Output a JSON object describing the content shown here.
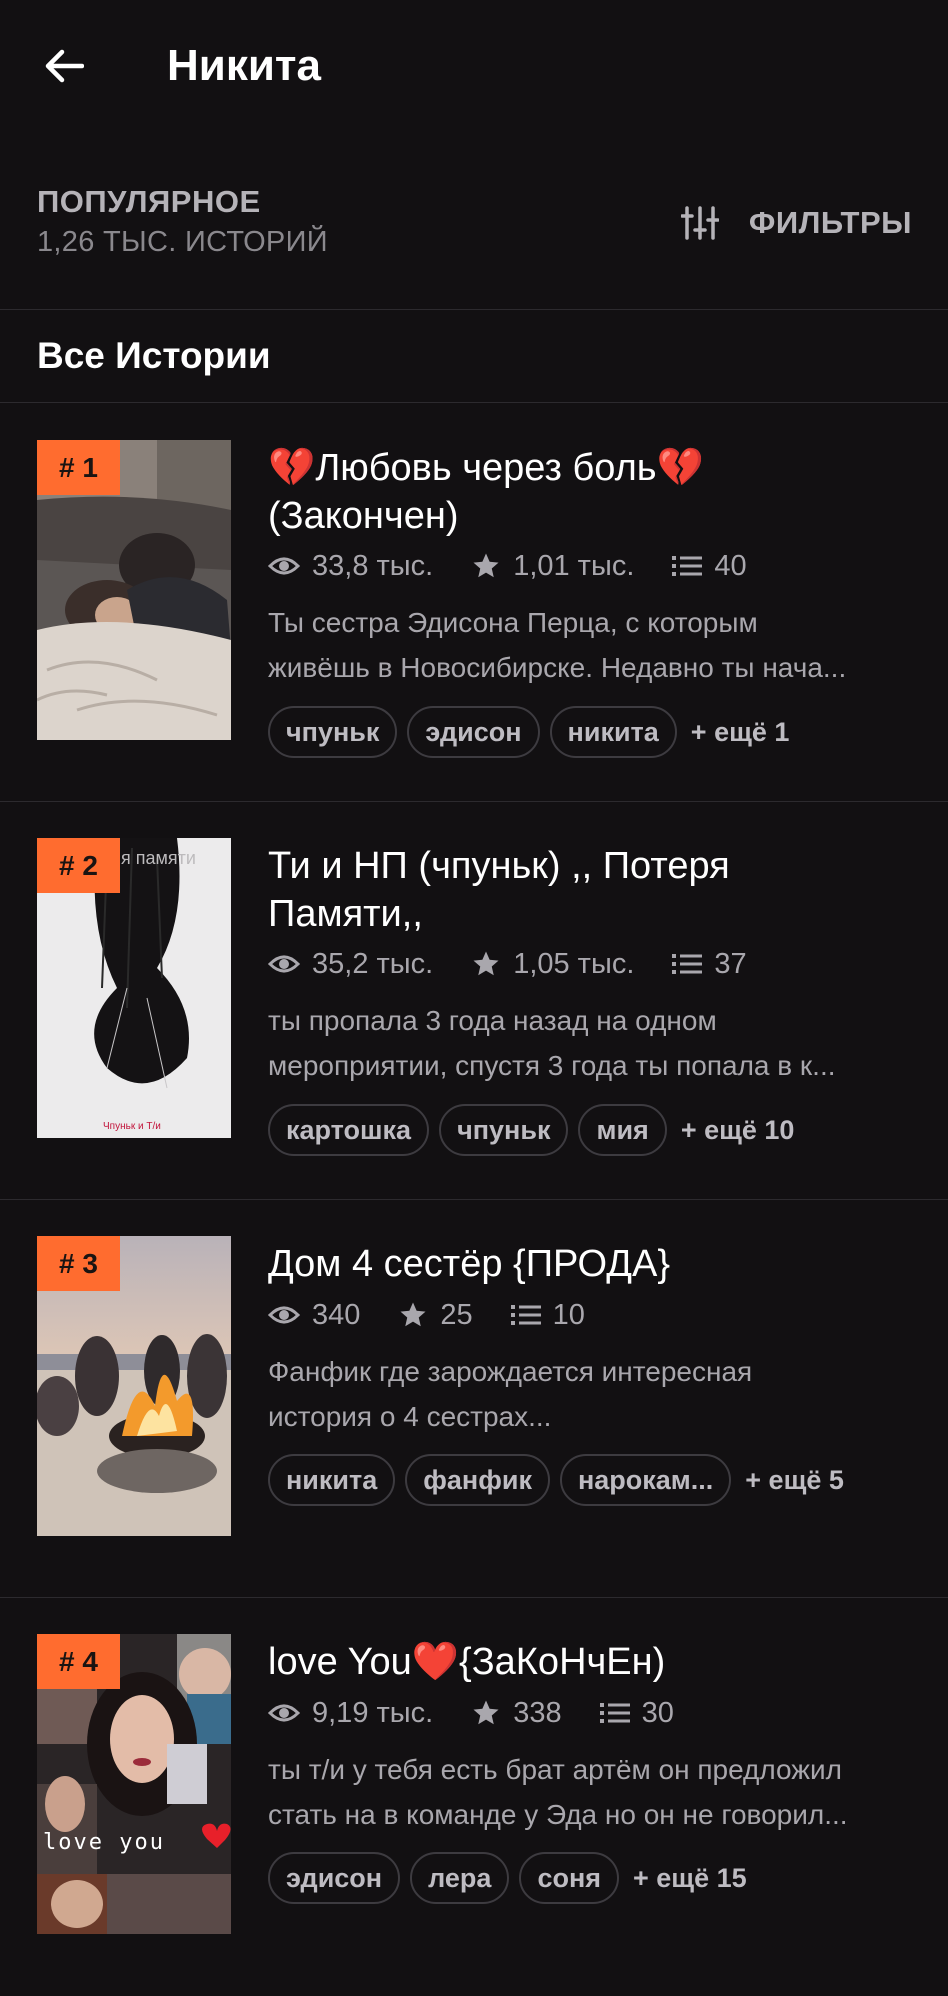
{
  "header": {
    "title": "Никита",
    "back_icon": "arrow-left-icon"
  },
  "sort": {
    "label": "ПОПУЛЯРНОЕ",
    "count": "1,26 ТЫС. ИСТОРИЙ",
    "filters_label": "ФИЛЬТРЫ",
    "filters_icon": "sliders-icon"
  },
  "section": {
    "title": "Все Истории"
  },
  "colors": {
    "background": "#121012",
    "rank_badge": "#ff6c2f",
    "muted_text": "#a9a7ad"
  },
  "stories": [
    {
      "rank": "# 1",
      "title_line1": "💔Любовь через боль💔",
      "title_line2": "(Закончен)",
      "reads": "33,8 тыс.",
      "votes": "1,01 тыс.",
      "parts": "40",
      "desc_line1": "Ты сестра Эдисона Перца, с которым",
      "desc_line2": "живёшь в Новосибирске. Недавно ты нача...",
      "tags": [
        "чпуньк",
        "эдисон",
        "никита"
      ],
      "more": "+ ещё 1"
    },
    {
      "rank": "# 2",
      "title_line1": "Ти и НП (чпуньк) ,, Потеря",
      "title_line2": "Памяти,,",
      "reads": "35,2 тыс.",
      "votes": "1,05 тыс.",
      "parts": "37",
      "desc_line1": "ты пропала 3 года назад на одном",
      "desc_line2": "мероприятии, спустя 3 года ты попала в к...",
      "tags": [
        "картошка",
        "чпуньк",
        "мия"
      ],
      "more": "+ ещё 10",
      "cover_text_top": "я памяти",
      "cover_text_bottom": "Чпуньк и Т/и"
    },
    {
      "rank": "# 3",
      "title_line1": "Дом 4 сестёр  {ПРОДА}",
      "reads": "340",
      "votes": "25",
      "parts": "10",
      "desc_line1": "Фанфик где зарождается интересная",
      "desc_line2": "история о 4 сестрах...",
      "tags": [
        "никита",
        "фанфик",
        "нарокам..."
      ],
      "more": "+ ещё 5"
    },
    {
      "rank": "# 4",
      "title_line1": "love You❤️{ЗаКоНчЕн)",
      "reads": "9,19 тыс.",
      "votes": "338",
      "parts": "30",
      "desc_line1": "ты т/и у тебя есть брат артём он предложил",
      "desc_line2": "стать на в команде у Эда но он не говорил...",
      "tags": [
        "эдисон",
        "лера",
        "соня"
      ],
      "more": "+ ещё 15",
      "cover_text": "love you"
    }
  ]
}
